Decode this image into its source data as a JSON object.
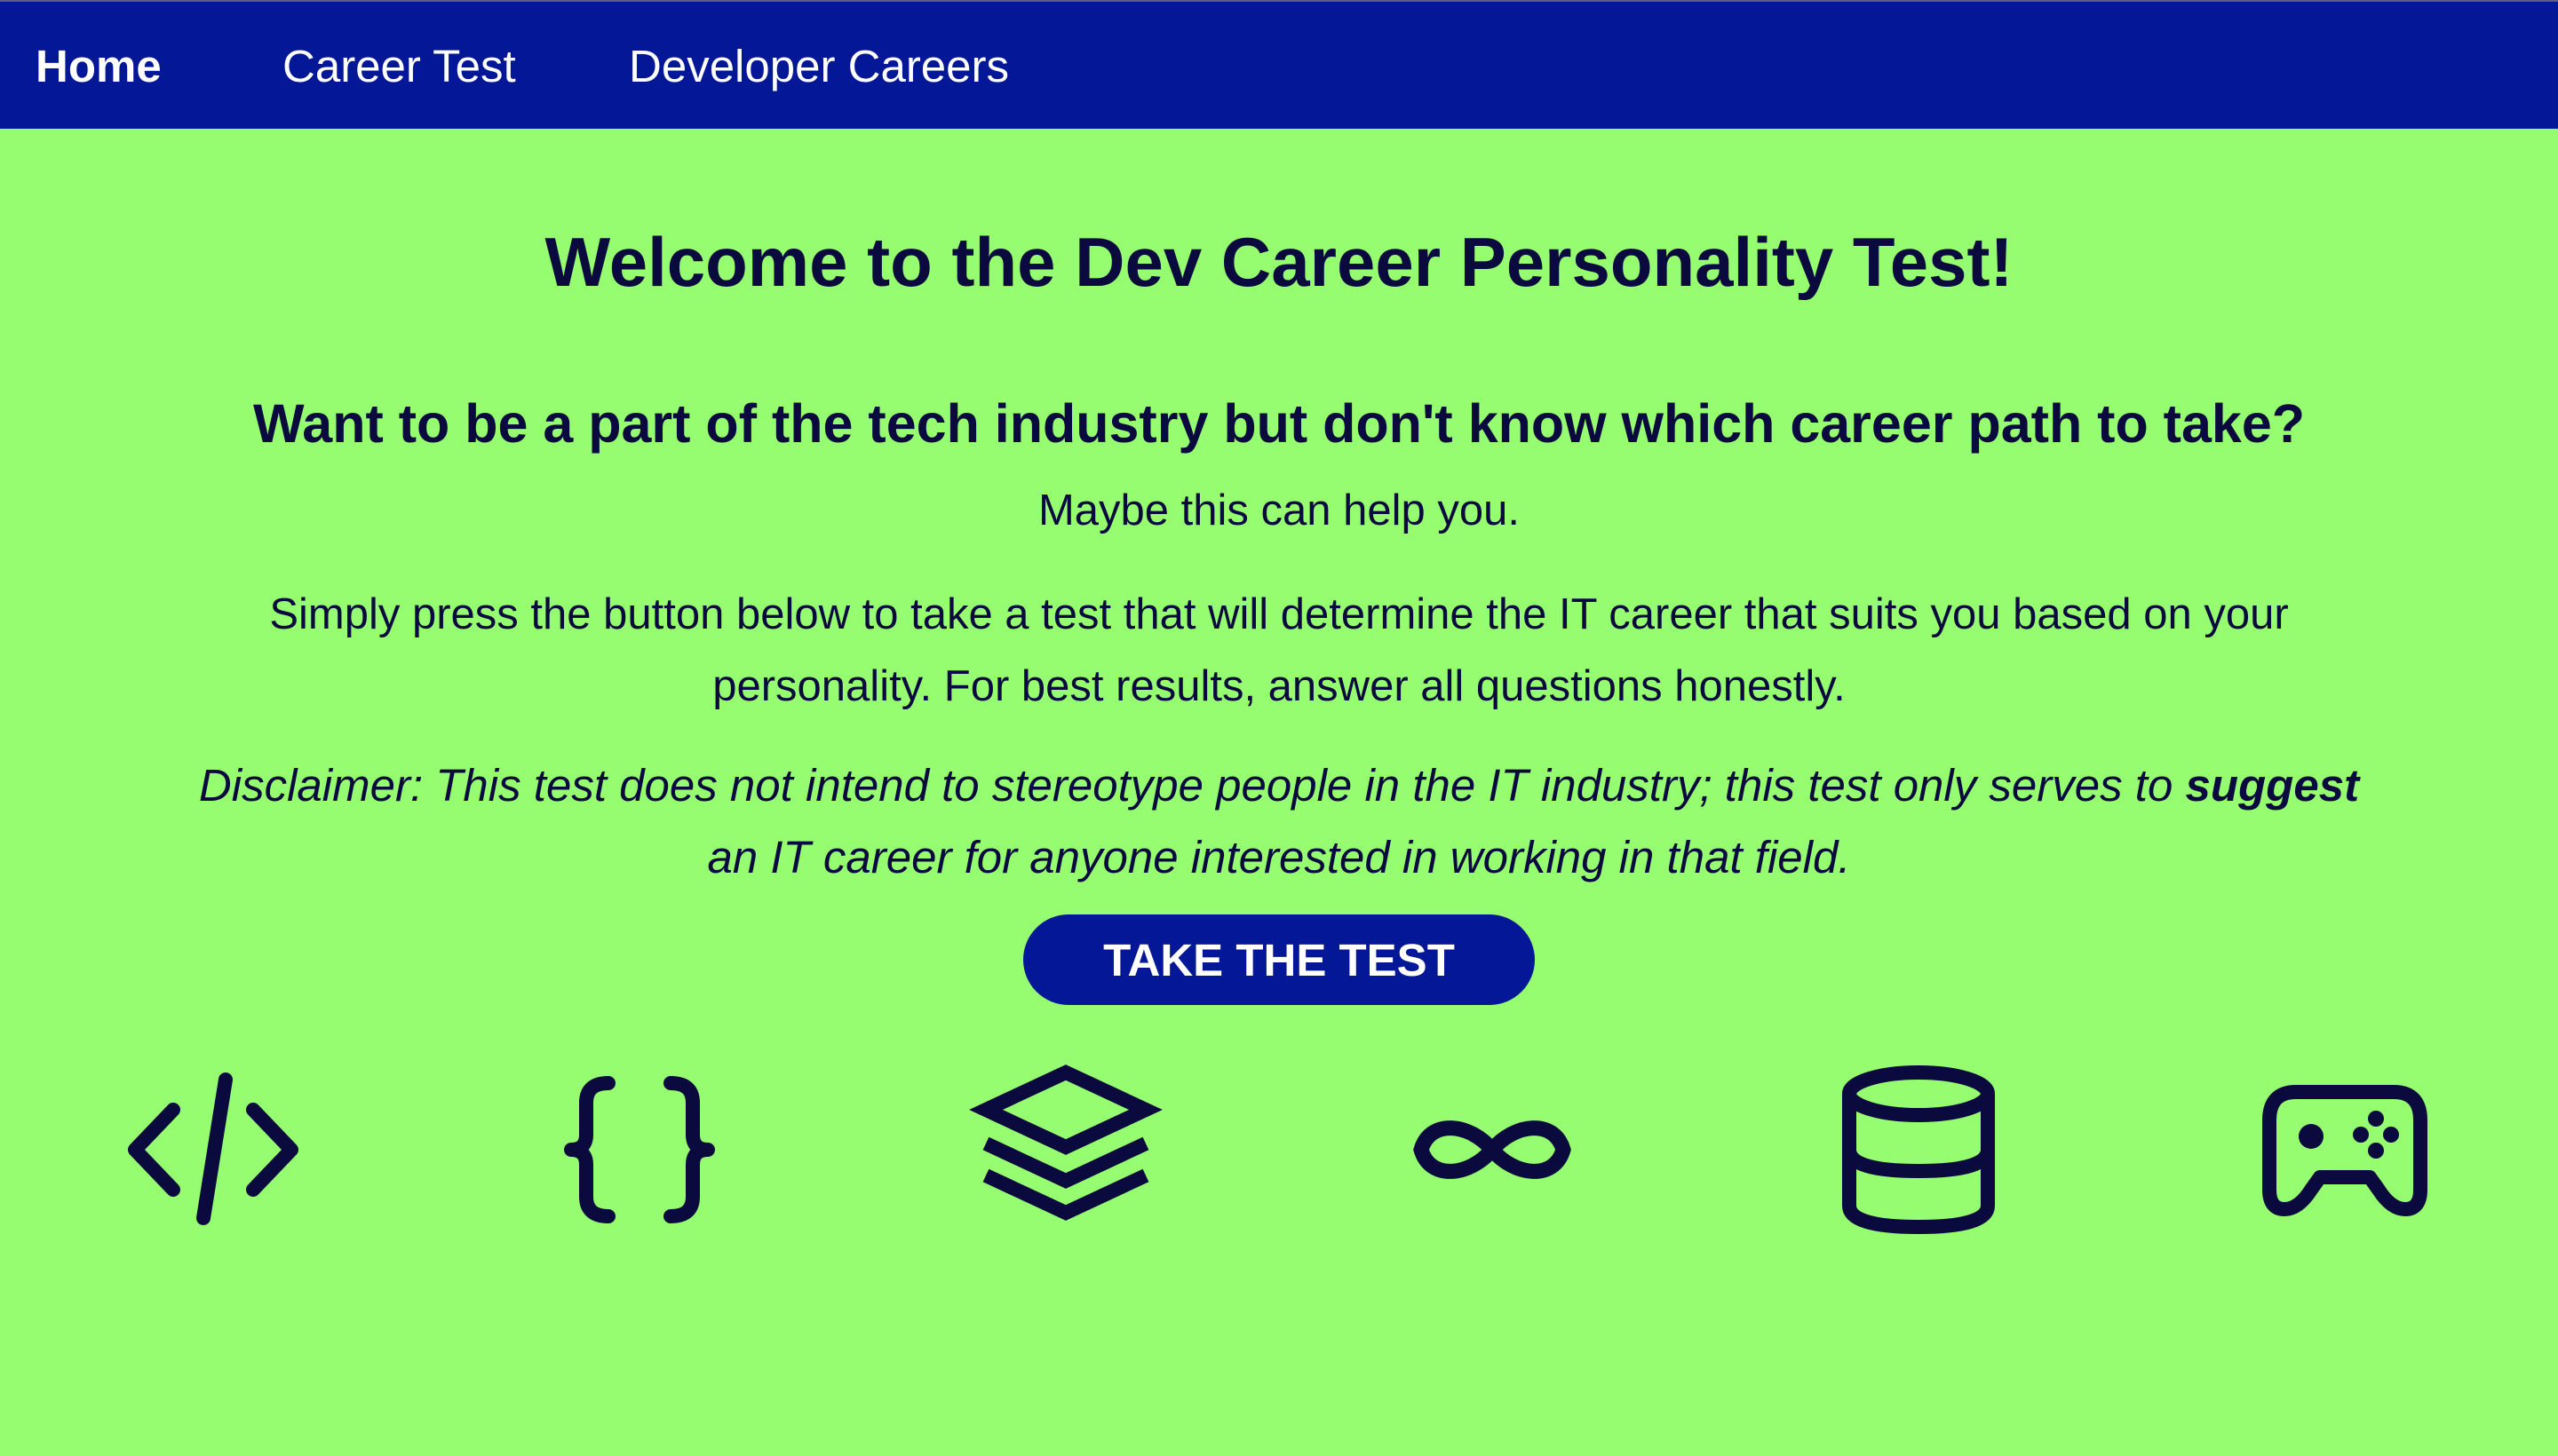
{
  "nav": {
    "items": [
      {
        "label": "Home",
        "active": true
      },
      {
        "label": "Career Test",
        "active": false
      },
      {
        "label": "Developer Careers",
        "active": false
      }
    ]
  },
  "main": {
    "title": "Welcome to the Dev Career Personality Test!",
    "subtitle": "Want to be a part of the tech industry but don't know which career path to take?",
    "lead": "Maybe this can help you.",
    "paragraph": "Simply press the button below to take a test that will determine the IT career that suits you based on your personality. For best results, answer all questions honestly.",
    "disclaimer": {
      "before": "Disclaimer: This test does not intend to stereotype people in the IT industry; this test only serves to ",
      "emphasis": "suggest",
      "after": " an IT career for anyone interested in working in that field."
    },
    "cta_label": "TAKE THE TEST"
  },
  "icons": [
    "code-icon",
    "curly-braces-icon",
    "layers-icon",
    "infinity-icon",
    "database-icon",
    "gamepad-icon"
  ],
  "colors": {
    "background": "#95fd6f",
    "navbar": "#041796",
    "text": "#0b0a3e",
    "button": "#041796",
    "button_text": "#ffffff"
  }
}
